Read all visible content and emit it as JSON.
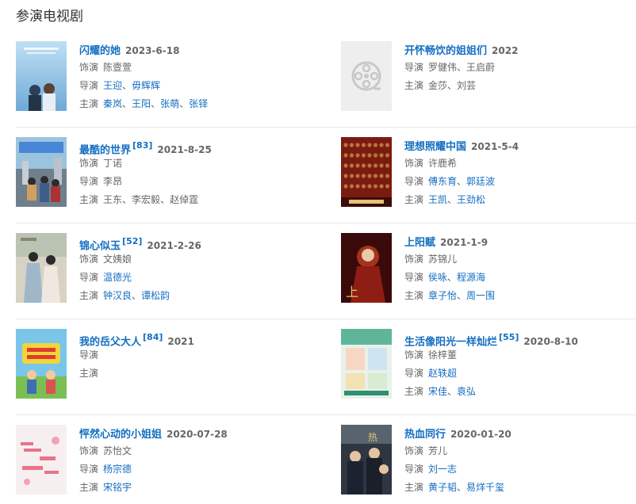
{
  "section_title": "参演电视剧",
  "labels": {
    "role": "饰演",
    "director": "导演",
    "star": "主演"
  },
  "dramas": [
    {
      "title": "闪耀的她",
      "ref": "",
      "date": "2023-6-18",
      "role": "陈壹萱",
      "directors": [
        "王迎",
        "毋辉辉"
      ],
      "director_links": true,
      "stars": [
        "秦岚",
        "王阳",
        "张萌",
        "张铎"
      ],
      "star_links": true,
      "poster": "poster-sky"
    },
    {
      "title": "开怀畅饮的姐姐们",
      "ref": "",
      "date": "2022",
      "role": "",
      "directors": [
        "罗健伟",
        "王启蔚"
      ],
      "director_links": false,
      "stars": [
        "金莎",
        "刘芸"
      ],
      "star_links": false,
      "poster": "film-reel-placeholder"
    },
    {
      "title": "最酷的世界",
      "ref": "[83]",
      "date": "2021-8-25",
      "role": "丁诺",
      "directors": [
        "李昂"
      ],
      "director_links": false,
      "stars": [
        "王东",
        "李宏毅",
        "赵倬霆"
      ],
      "star_links": false,
      "poster": "poster-city"
    },
    {
      "title": "理想照耀中国",
      "ref": "",
      "date": "2021-5-4",
      "role": "许鹿希",
      "directors": [
        "傅东育",
        "郭廷波"
      ],
      "director_links": true,
      "stars": [
        "王凯",
        "王劲松"
      ],
      "star_links": true,
      "poster": "poster-red"
    },
    {
      "title": "锦心似玉",
      "ref": "[52]",
      "date": "2021-2-26",
      "role": "文姨娘",
      "directors": [
        "温德光"
      ],
      "director_links": true,
      "stars": [
        "钟汉良",
        "谭松韵"
      ],
      "star_links": true,
      "poster": "poster-costume"
    },
    {
      "title": "上阳赋",
      "ref": "",
      "date": "2021-1-9",
      "role": "苏锦儿",
      "directors": [
        "侯咏",
        "程源海"
      ],
      "director_links": true,
      "stars": [
        "章子怡",
        "周一围"
      ],
      "star_links": true,
      "poster": "poster-dark-red"
    },
    {
      "title": "我的岳父大人",
      "ref": "[84]",
      "date": "2021",
      "role": "",
      "directors": [],
      "director_links": false,
      "stars": [],
      "star_links": false,
      "poster": "poster-cartoon"
    },
    {
      "title": "生活像阳光一样灿烂",
      "ref": "[55]",
      "date": "2020-8-10",
      "role": "徐梓董",
      "directors": [
        "赵轶超"
      ],
      "director_links": true,
      "stars": [
        "宋佳",
        "袁弘"
      ],
      "star_links": true,
      "poster": "poster-green"
    },
    {
      "title": "怦然心动的小姐姐",
      "ref": "",
      "date": "2020-07-28",
      "role": "苏怡文",
      "directors": [
        "杨宗德"
      ],
      "director_links": true,
      "stars": [
        "宋铭宇"
      ],
      "star_links": true,
      "poster": "poster-pink"
    },
    {
      "title": "热血同行",
      "ref": "",
      "date": "2020-01-20",
      "role": "芳儿",
      "directors": [
        "刘一志"
      ],
      "director_links": true,
      "stars": [
        "黄子韬",
        "易烊千玺"
      ],
      "star_links": true,
      "poster": "poster-police"
    }
  ]
}
